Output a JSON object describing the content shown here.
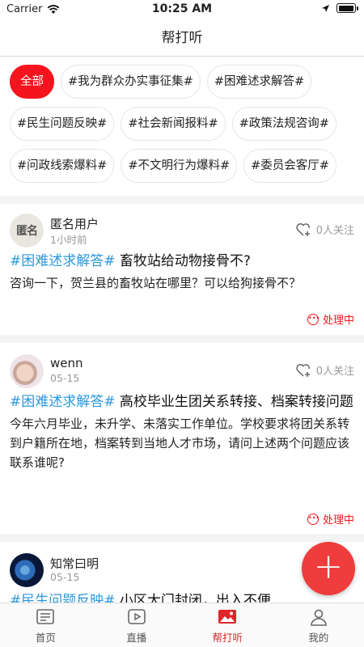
{
  "status_bar": {
    "carrier": "Carrier",
    "time": "10:25 AM"
  },
  "nav": {
    "title": "帮打听"
  },
  "tags": [
    [
      "全部",
      "#我为群众办实事征集#",
      "#困难述求解答#"
    ],
    [
      "#民生问题反映#",
      "#社会新闻报料#",
      "#政策法规咨询#"
    ],
    [
      "#问政线索爆料#",
      "#不文明行为爆料#",
      "#委员会客厅#"
    ]
  ],
  "posts": [
    {
      "avatar_text": "匿名",
      "user": "匿名用户",
      "time": "1小时前",
      "follow": "0人关注",
      "hashtag": "#困难述求解答#",
      "title": " 畜牧站给动物接骨不?",
      "body": "咨询一下，贺兰县的畜牧站在哪里？可以给狗接骨不？",
      "status": "处理中"
    },
    {
      "user": "wenn",
      "time": "05-15",
      "follow": "0人关注",
      "hashtag": "#困难述求解答#",
      "title": " 高校毕业生团关系转接、档案转接问题",
      "body": "今年六月毕业，未升学、未落实工作单位。学校要求将团关系转到户籍所在地，档案转到当地人才市场，请问上述两个问题应该联系谁呢?",
      "status": "处理中"
    },
    {
      "user": "知常曰明",
      "time": "05-15",
      "hashtag": "#民生问题反映#",
      "title": " 小区大门封闭，出入不便"
    }
  ],
  "tabbar": [
    {
      "label": "首页",
      "icon": "news-icon"
    },
    {
      "label": "直播",
      "icon": "play-icon"
    },
    {
      "label": "帮打听",
      "icon": "image-icon",
      "active": true
    },
    {
      "label": "我的",
      "icon": "person-icon"
    }
  ],
  "colors": {
    "accent": "#f5141e",
    "hashtag": "#2a98dc"
  }
}
